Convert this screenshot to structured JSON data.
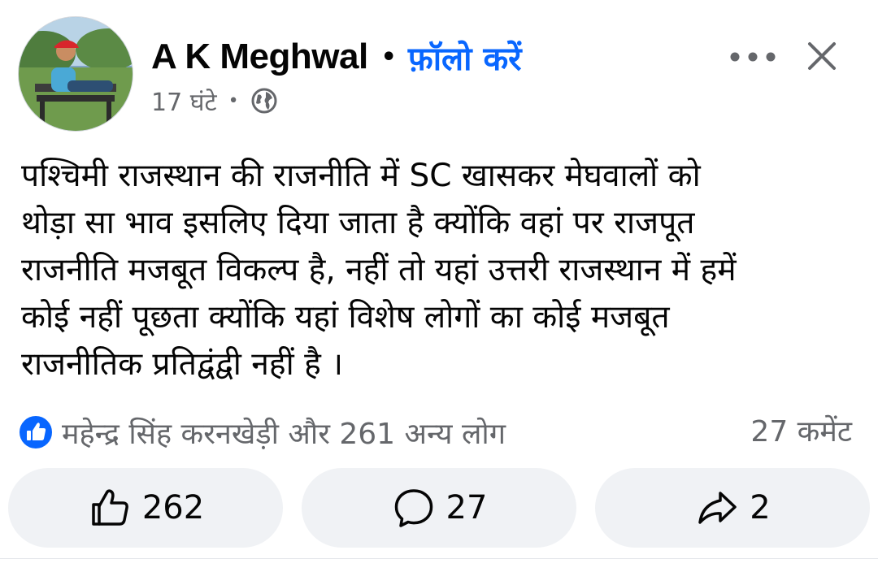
{
  "post": {
    "author_name": "A K Meghwal",
    "follow_label": "फ़ॉलो करें",
    "time": "17 घंटे",
    "privacy_icon": "globe-icon",
    "text": "पश्चिमी राजस्थान की राजनीति में SC खासकर मेघवालों को\nथोड़ा सा भाव इसलिए दिया जाता है क्योंकि वहां पर राजपूत\nराजनीति मजबूत विकल्प है, नहीं तो यहां उत्तरी राजस्थान में हमें\nकोई नहीं पूछता क्योंकि यहां विशेष लोगों का कोई मजबूत\nराजनीतिक प्रतिद्वंद्वी नहीं है ।"
  },
  "reactions": {
    "summary": "महेन्द्र सिंह करनखेड़ी और 261 अन्य लोग",
    "comments_summary": "27 कमेंट",
    "like_badge_color": "#0866ff"
  },
  "actions": {
    "like_count": "262",
    "comment_count": "27",
    "share_count": "2"
  },
  "colors": {
    "accent": "#0866ff",
    "secondary_text": "#65676b",
    "button_bg": "#f0f2f5"
  }
}
